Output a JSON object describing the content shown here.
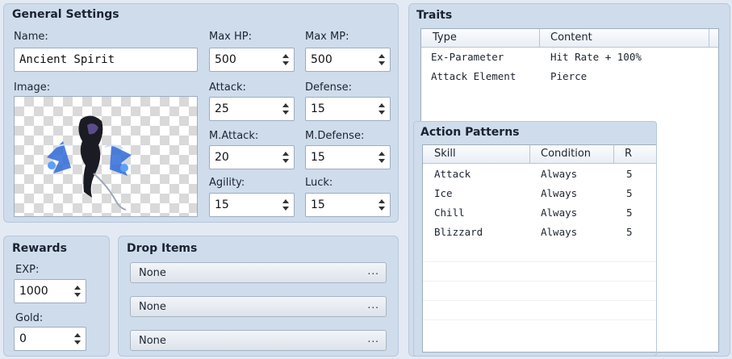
{
  "general": {
    "title": "General Settings",
    "name_label": "Name:",
    "name_value": "Ancient Spirit",
    "image_label": "Image:",
    "max_hp_label": "Max HP:",
    "max_hp": "500",
    "max_mp_label": "Max MP:",
    "max_mp": "500",
    "attack_label": "Attack:",
    "attack": "25",
    "defense_label": "Defense:",
    "defense": "15",
    "mattack_label": "M.Attack:",
    "mattack": "20",
    "mdefense_label": "M.Defense:",
    "mdefense": "15",
    "agility_label": "Agility:",
    "agility": "15",
    "luck_label": "Luck:",
    "luck": "15"
  },
  "rewards": {
    "title": "Rewards",
    "exp_label": "EXP:",
    "exp": "1000",
    "gold_label": "Gold:",
    "gold": "0"
  },
  "drops": {
    "title": "Drop Items",
    "items": [
      "None",
      "None",
      "None"
    ],
    "more_glyph": "..."
  },
  "traits": {
    "title": "Traits",
    "columns": [
      "Type",
      "Content"
    ],
    "rows": [
      {
        "type": "Ex-Parameter",
        "content": "Hit Rate + 100%"
      },
      {
        "type": "Attack Element",
        "content": "Pierce"
      }
    ]
  },
  "actions": {
    "title": "Action Patterns",
    "columns": [
      "Skill",
      "Condition",
      "R"
    ],
    "rows": [
      {
        "skill": "Attack",
        "condition": "Always",
        "r": "5"
      },
      {
        "skill": "Ice",
        "condition": "Always",
        "r": "5"
      },
      {
        "skill": "Chill",
        "condition": "Always",
        "r": "5"
      },
      {
        "skill": "Blizzard",
        "condition": "Always",
        "r": "5"
      }
    ]
  },
  "colors": {
    "panel": "#cfdcec",
    "background": "#e4eaf3",
    "accent_blue": "#3a6fe0"
  },
  "sprite": {
    "icon": "enemy-sprite-icon"
  }
}
